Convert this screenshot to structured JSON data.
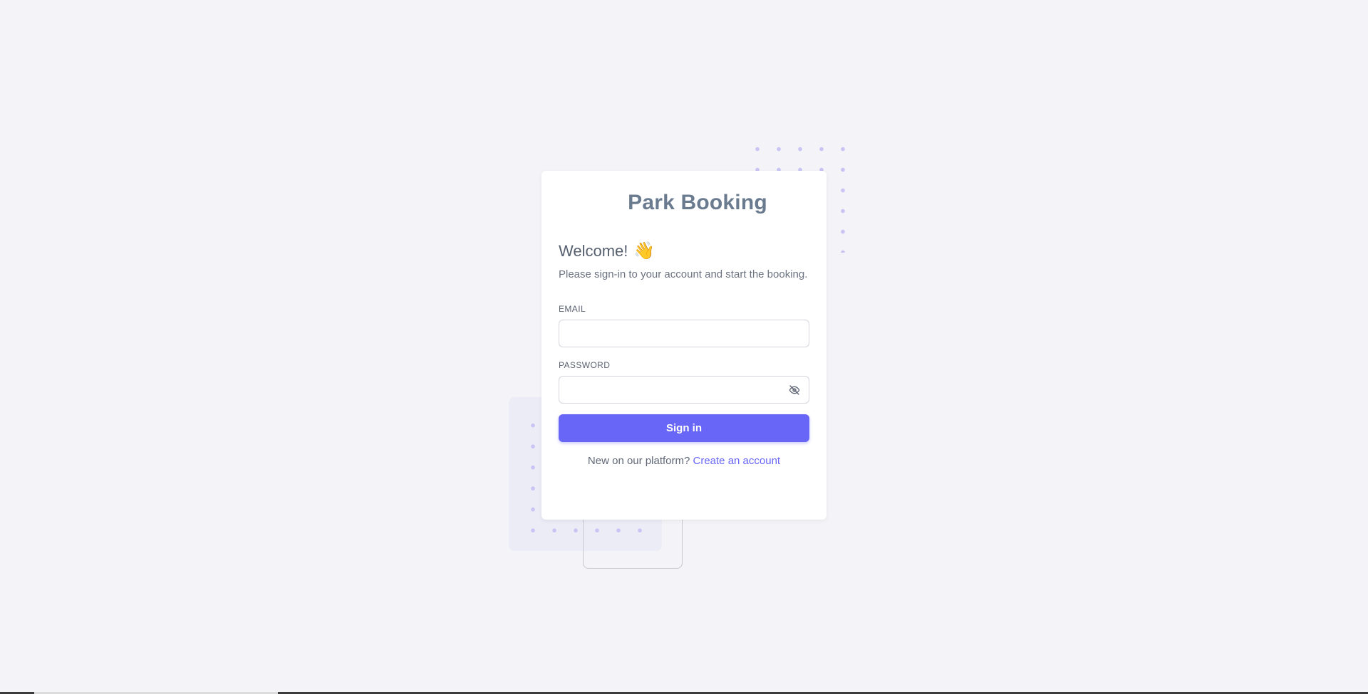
{
  "app": {
    "brand": "Park Booking"
  },
  "login": {
    "welcome": "Welcome!",
    "welcome_icon": "waving-hand-icon",
    "subtitle": "Please sign-in to your account and start the booking.",
    "email_label": "EMAIL",
    "email_value": "",
    "email_placeholder": "",
    "password_label": "PASSWORD",
    "password_value": "",
    "password_placeholder": "",
    "password_toggle_icon": "eye-off-icon",
    "signin_label": "Sign in",
    "footer_text": "New on our platform?",
    "footer_link": "Create an account"
  },
  "colors": {
    "background": "#f4f4f8",
    "primary": "#6866f6",
    "brand_text": "#6a7b8f",
    "decor_dots": "#c9c4f3"
  }
}
